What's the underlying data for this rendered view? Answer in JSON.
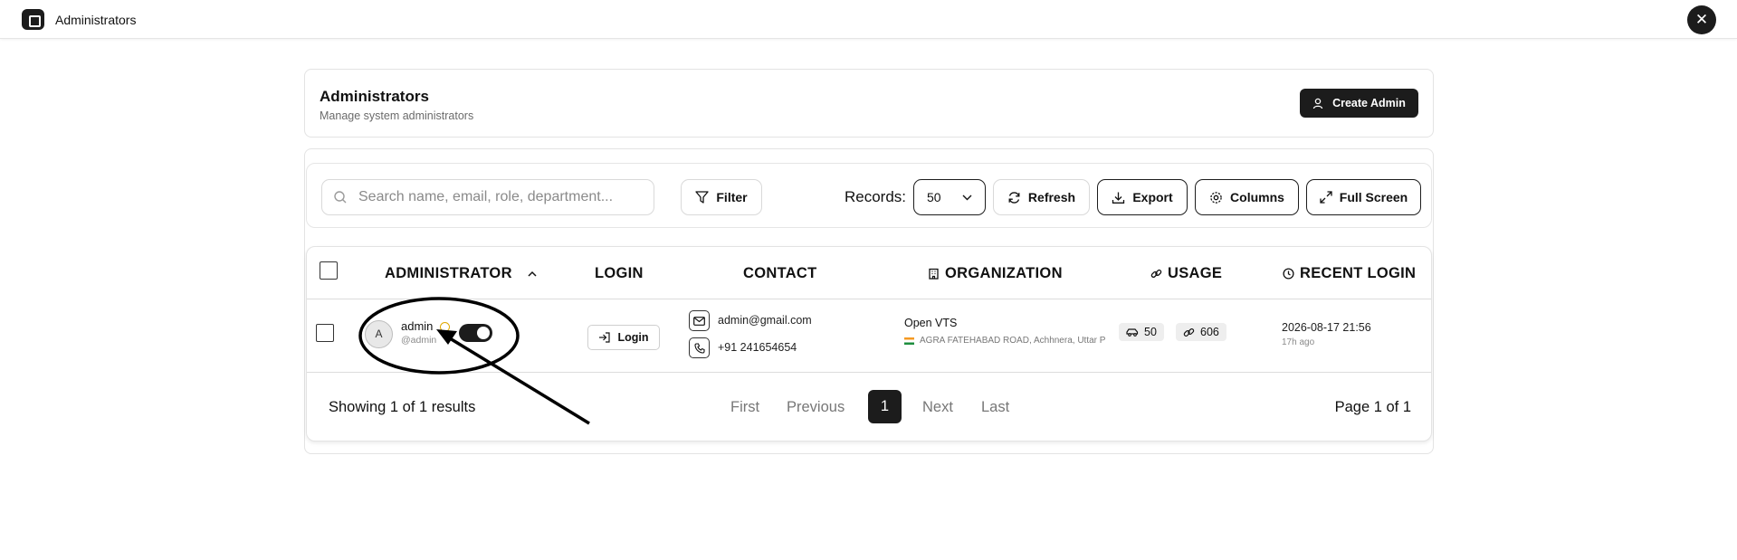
{
  "app": {
    "title": "Administrators",
    "logo_icon": "app-square-icon",
    "close_icon": "close-icon"
  },
  "header": {
    "title": "Administrators",
    "subtitle": "Manage system administrators",
    "create_button": "Create Admin"
  },
  "toolbar": {
    "search_placeholder": "Search name, email, role, department...",
    "filter_label": "Filter",
    "records_label": "Records:",
    "records_value": "50",
    "refresh_label": "Refresh",
    "export_label": "Export",
    "columns_label": "Columns",
    "fullscreen_label": "Full Screen"
  },
  "table": {
    "columns": {
      "administrator": "ADMINISTRATOR",
      "login": "LOGIN",
      "contact": "CONTACT",
      "organization": "ORGANIZATION",
      "usage": "USAGE",
      "recent_login": "RECENT LOGIN"
    },
    "rows": [
      {
        "avatar_initial": "A",
        "name": "admin",
        "handle": "@admin",
        "active": true,
        "login_label": "Login",
        "email": "admin@gmail.com",
        "phone": "+91 241654654",
        "org_name": "Open VTS",
        "org_address": "AGRA FATEHABAD ROAD, Achhnera, Uttar P",
        "vehicles": "50",
        "links": "606",
        "recent_login": "2026-08-17 21:56",
        "recent_ago": "17h ago"
      }
    ]
  },
  "pagination": {
    "results": "Showing 1 of 1 results",
    "first": "First",
    "previous": "Previous",
    "current": "1",
    "next": "Next",
    "last": "Last",
    "page_of": "Page 1 of 1"
  },
  "colors": {
    "accent": "#1c1c1c",
    "warning": "#e0a800",
    "border": "#e3e3e3"
  }
}
